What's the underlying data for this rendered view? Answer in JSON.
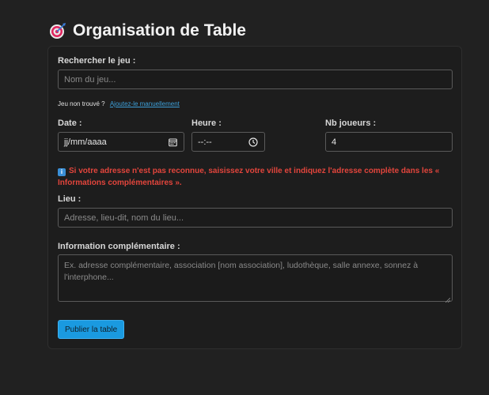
{
  "header": {
    "title": "Organisation de Table",
    "icon": "dart-target-icon"
  },
  "form": {
    "search": {
      "label": "Rechercher le jeu :",
      "placeholder": "Nom du jeu..."
    },
    "not_found": {
      "text": "Jeu non trouvé ?",
      "link": "Ajoutez-le manuellement"
    },
    "date": {
      "label": "Date :",
      "value": "jj/mm/aaaa",
      "icon": "calendar-icon"
    },
    "time": {
      "label": "Heure :",
      "value": "--:--",
      "icon": "clock-icon"
    },
    "players": {
      "label": "Nb joueurs :",
      "value": "4"
    },
    "warning": {
      "icon": "info-icon",
      "icon_glyph": "i",
      "text": "Si votre adresse n'est pas reconnue, saisissez votre ville et indiquez l'adresse complète dans les « Informations complémentaires »."
    },
    "place": {
      "label": "Lieu :",
      "placeholder": "Adresse, lieu-dit, nom du lieu..."
    },
    "extra": {
      "label": "Information complémentaire :",
      "placeholder": "Ex. adresse complémentaire, association [nom association], ludothèque, salle annexe, sonnez à l'interphone..."
    },
    "submit_label": "Publier la table"
  },
  "colors": {
    "background": "#212121",
    "accent": "#1a9ae0",
    "warning": "#e2453c",
    "link": "#3d9fd8"
  }
}
